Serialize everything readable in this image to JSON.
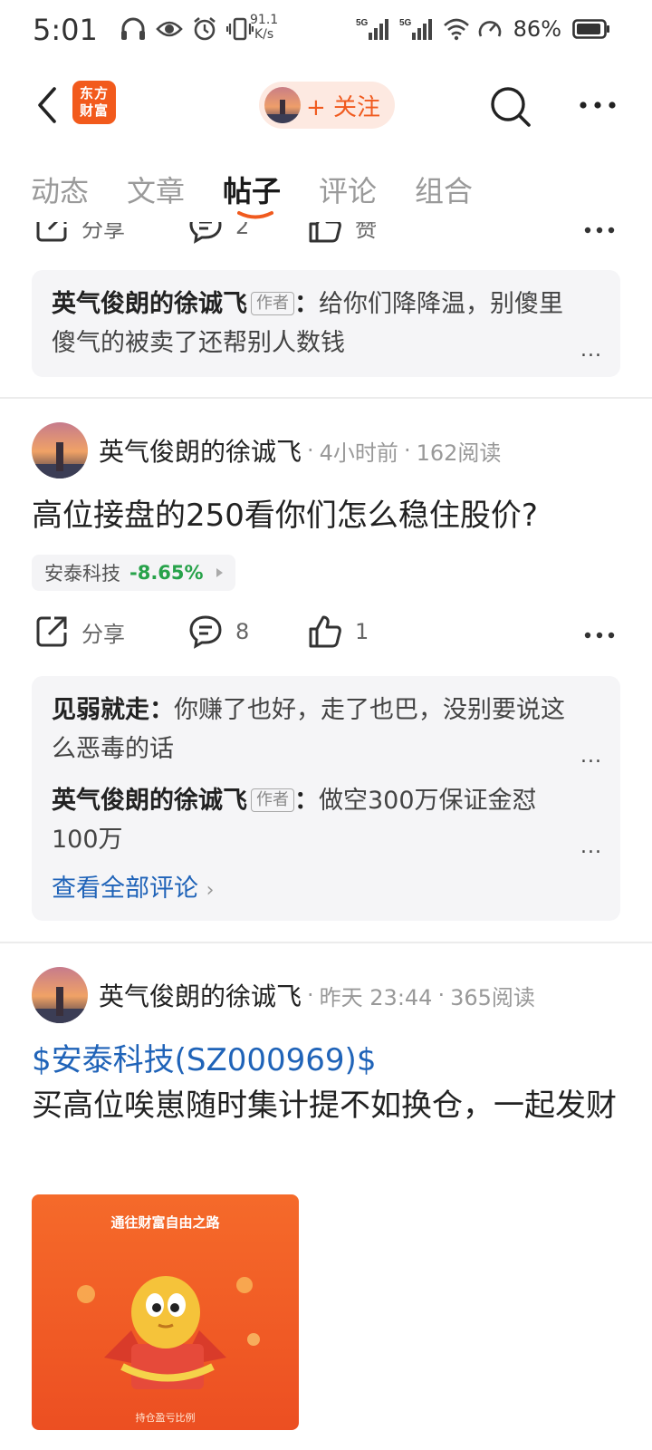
{
  "status_bar": {
    "time": "5:01",
    "net_speed_value": "91.1",
    "net_speed_unit": "K/s",
    "sim1": "5G",
    "sim2": "5G",
    "battery_pct": "86%"
  },
  "header": {
    "logo_line1": "东方",
    "logo_line2": "财富",
    "follow_label": "+ 关注"
  },
  "tabs": [
    {
      "label": "动态",
      "active": false
    },
    {
      "label": "文章",
      "active": false
    },
    {
      "label": "帖子",
      "active": true
    },
    {
      "label": "评论",
      "active": false
    },
    {
      "label": "组合",
      "active": false
    }
  ],
  "feed": {
    "post0": {
      "actions": {
        "share": "分享",
        "comments": "2",
        "like": "赞"
      },
      "comments": [
        {
          "author": "英气俊朗的徐诚飞",
          "tag": "作者",
          "text": "给你们降降温，别傻里傻气的被卖了还帮别人数钱"
        }
      ]
    },
    "post1": {
      "author": "英气俊朗的徐诚飞",
      "time": "4小时前",
      "reads": "162阅读",
      "title": "高位接盘的250看你们怎么稳住股价?",
      "stock": {
        "name": "安泰科技",
        "change": "-8.65%",
        "change_color": "#27a24a"
      },
      "actions": {
        "share": "分享",
        "comments": "8",
        "like": "1"
      },
      "comments": [
        {
          "author": "见弱就走",
          "tag": "",
          "text": "你赚了也好，走了也巴，没别要说这么恶毒的话"
        },
        {
          "author": "英气俊朗的徐诚飞",
          "tag": "作者",
          "text": "做空300万保证金怼100万"
        }
      ],
      "view_all": "查看全部评论"
    },
    "post2": {
      "author": "英气俊朗的徐诚飞",
      "time": "昨天 23:44",
      "reads": "365阅读",
      "stock_link": "$安泰科技(SZ000969)$",
      "body": "买高位唉崽随时集计提不如换仓，一起发财",
      "image": {
        "banner": "通往财富自由之路",
        "caption": "持仓盈亏比例"
      }
    }
  },
  "colors": {
    "accent": "#f05a1e",
    "link": "#1f63b8",
    "down": "#27a24a"
  }
}
